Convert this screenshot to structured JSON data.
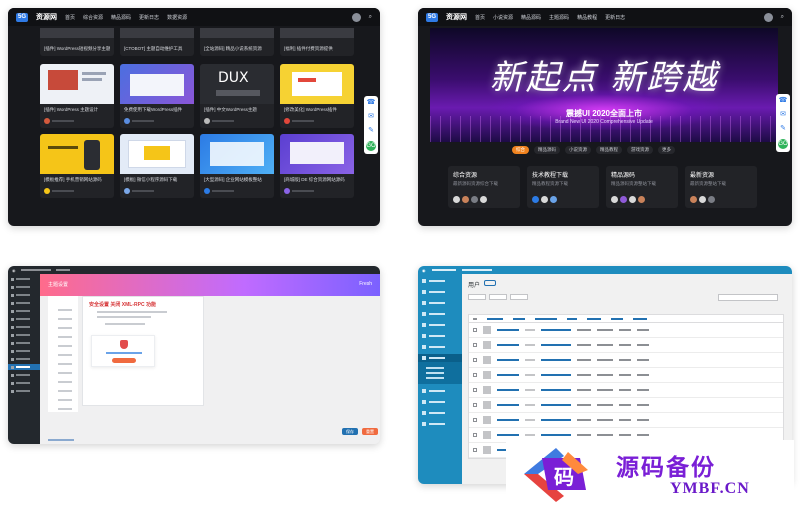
{
  "top_left": {
    "nav": {
      "logo": "5G",
      "site": "资源网",
      "items": [
        "首页",
        "综合资源",
        "精品源码",
        "更新日志",
        "数据资源"
      ]
    },
    "top_captions": [
      "[插件] WordPress短视频分享主题",
      "[CTOBOT] 主题自动维护工具",
      "[全站源码] 精品小说系统资源",
      "[福利] 插件付费资源提供"
    ],
    "cards": [
      {
        "caption": "[插件] WordPress 主题设计",
        "theme": "#e9ecf3"
      },
      {
        "caption": "免费使用下载WordPress插件",
        "theme": "#3e5fd0"
      },
      {
        "caption": "[插件] 中文WordPress主题",
        "theme": "#33353c"
      },
      {
        "caption": "[修改美化] WordPress插件",
        "theme": "#f6d233"
      },
      {
        "caption": "[模板推荐] 手机营销网站源码",
        "theme": "#f5c518"
      },
      {
        "caption": "[模板] 微信小程序源码下载",
        "theme": "#e3ebf7"
      },
      {
        "caption": "[大型源码] 企业网站模板整站",
        "theme": "#2c7be5"
      },
      {
        "caption": "[商城版] DE 综合资源网站源码",
        "theme": "#5b3fd1"
      }
    ],
    "dux_text": "DUX",
    "dock": [
      "客服",
      "微信",
      "投稿",
      "GO"
    ]
  },
  "top_right": {
    "nav": {
      "logo": "5G",
      "site": "资源网",
      "items": [
        "首页",
        "小说资源",
        "精品源码",
        "主题源码",
        "精品教程",
        "更新日志"
      ]
    },
    "hero_headline": "新起点 新跨越",
    "hero_sub": "震撼UI 2020全面上市",
    "hero_sub2": "Brand New UI 2020 Comprehensive Update",
    "pills": [
      "综合",
      "精品源码",
      "小说资源",
      "精品教程",
      "游戏资源",
      "更多"
    ],
    "categories": [
      {
        "title": "综合资源",
        "sub": "最新源码资源综合下载"
      },
      {
        "title": "技术教程下载",
        "sub": "精品教程资源下载"
      },
      {
        "title": "精品源码",
        "sub": "精品源码资源整站下载"
      },
      {
        "title": "最新资源",
        "sub": "最新资源整站下载"
      }
    ]
  },
  "bottom_left": {
    "header_title": "主题设置",
    "header_right": "Fresh",
    "panel_title": "安全设置 关闭 XML-RPC 功能",
    "save_label": "保存",
    "reset_label": "重置"
  },
  "bottom_right": {
    "page_title": "用户",
    "rows": 9
  },
  "watermark": {
    "mark_char": "码",
    "name": "源码备份",
    "domain": "YMBF.CN"
  }
}
